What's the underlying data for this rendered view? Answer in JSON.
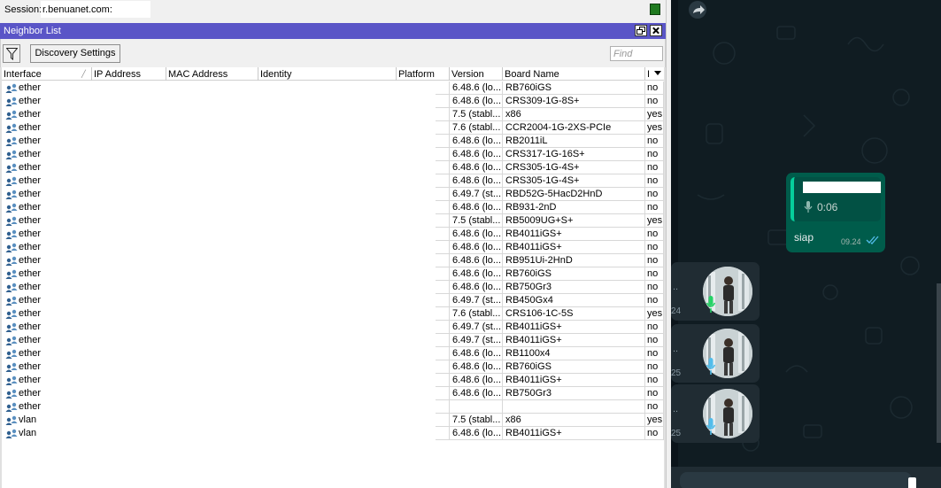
{
  "session": {
    "label": "Session:",
    "value": "r.benuanet.com:"
  },
  "neighbor_list": {
    "title": "Neighbor List",
    "toolbar": {
      "discovery_settings_label": "Discovery Settings",
      "find_placeholder": "Find"
    },
    "columns": [
      "Interface",
      "IP Address",
      "MAC Address",
      "Identity",
      "Platform",
      "Version",
      "Board Name",
      "I"
    ],
    "rows": [
      {
        "interface": "ether",
        "version": "6.48.6 (lo...",
        "board": "RB760iGS",
        "last": "no"
      },
      {
        "interface": "ether",
        "version": "6.48.6 (lo...",
        "board": "CRS309-1G-8S+",
        "last": "no"
      },
      {
        "interface": "ether",
        "version": "7.5 (stabl...",
        "board": "x86",
        "last": "yes"
      },
      {
        "interface": "ether",
        "version": "7.6 (stabl...",
        "board": "CCR2004-1G-2XS-PCIe",
        "last": "yes"
      },
      {
        "interface": "ether",
        "version": "6.48.6 (lo...",
        "board": "RB2011iL",
        "last": "no"
      },
      {
        "interface": "ether",
        "version": "6.48.6 (lo...",
        "board": "CRS317-1G-16S+",
        "last": "no"
      },
      {
        "interface": "ether",
        "version": "6.48.6 (lo...",
        "board": "CRS305-1G-4S+",
        "last": "no"
      },
      {
        "interface": "ether",
        "version": "6.48.6 (lo...",
        "board": "CRS305-1G-4S+",
        "last": "no"
      },
      {
        "interface": "ether",
        "version": "6.49.7 (st...",
        "board": "RBD52G-5HacD2HnD",
        "last": "no"
      },
      {
        "interface": "ether",
        "version": "6.48.6 (lo...",
        "board": "RB931-2nD",
        "last": "no"
      },
      {
        "interface": "ether",
        "version": "7.5 (stabl...",
        "board": "RB5009UG+S+",
        "last": "yes"
      },
      {
        "interface": "ether",
        "version": "6.48.6 (lo...",
        "board": "RB4011iGS+",
        "last": "no"
      },
      {
        "interface": "ether",
        "version": "6.48.6 (lo...",
        "board": "RB4011iGS+",
        "last": "no"
      },
      {
        "interface": "ether",
        "version": "6.48.6 (lo...",
        "board": "RB951Ui-2HnD",
        "last": "no"
      },
      {
        "interface": "ether",
        "version": "6.48.6 (lo...",
        "board": "RB760iGS",
        "last": "no"
      },
      {
        "interface": "ether",
        "version": "6.48.6 (lo...",
        "board": "RB750Gr3",
        "last": "no"
      },
      {
        "interface": "ether",
        "version": "6.49.7 (st...",
        "board": "RB450Gx4",
        "last": "no"
      },
      {
        "interface": "ether",
        "version": "7.6 (stabl...",
        "board": "CRS106-1C-5S",
        "last": "yes"
      },
      {
        "interface": "ether",
        "version": "6.49.7 (st...",
        "board": "RB4011iGS+",
        "last": "no"
      },
      {
        "interface": "ether",
        "version": "6.49.7 (st...",
        "board": "RB4011iGS+",
        "last": "no"
      },
      {
        "interface": "ether",
        "version": "6.48.6 (lo...",
        "board": "RB1100x4",
        "last": "no"
      },
      {
        "interface": "ether",
        "version": "6.48.6 (lo...",
        "board": "RB760iGS",
        "last": "no"
      },
      {
        "interface": "ether",
        "version": "6.48.6 (lo...",
        "board": "RB4011iGS+",
        "last": "no"
      },
      {
        "interface": "ether",
        "version": "6.48.6 (lo...",
        "board": "RB750Gr3",
        "last": "no"
      },
      {
        "interface": "ether",
        "version": "",
        "board": "",
        "last": "no"
      },
      {
        "interface": "vlan",
        "version": "7.5 (stabl...",
        "board": "x86",
        "last": "yes"
      },
      {
        "interface": "vlan",
        "version": "6.48.6 (lo...",
        "board": "RB4011iGS+",
        "last": "no"
      }
    ]
  },
  "chat": {
    "bubble": {
      "quoted_duration": "0:06",
      "text": "siap",
      "time": "09.24"
    },
    "voice_items": [
      {
        "time": "24",
        "mic_color": "#25d366"
      },
      {
        "time": "25",
        "mic_color": "#53bdeb"
      },
      {
        "time": "25",
        "mic_color": "#53bdeb"
      }
    ]
  },
  "colors": {
    "titlebar": "#5a55c7",
    "chat_bg": "#101c22",
    "outgoing_bubble": "#005c4b",
    "incoming_bubble": "#202c33"
  }
}
